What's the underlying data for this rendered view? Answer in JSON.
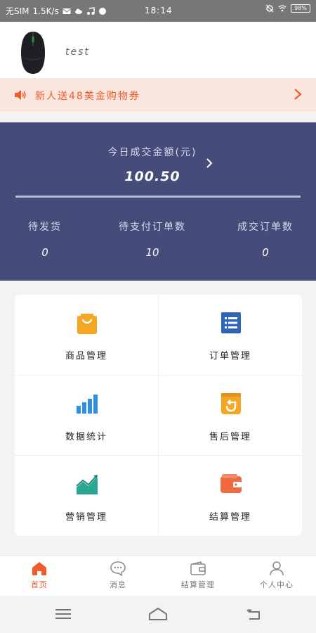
{
  "status_bar": {
    "carrier": "无SIM",
    "net_speed": "1.5K/s",
    "time": "18:14",
    "battery": "98%"
  },
  "profile": {
    "shop_name": "test"
  },
  "notice": {
    "text": "新人送48美金购物券"
  },
  "stats": {
    "amount_label": "今日成交金额(元)",
    "amount_value": "100.50",
    "columns": [
      {
        "label": "待发货",
        "value": "0"
      },
      {
        "label": "待支付订单数",
        "value": "10"
      },
      {
        "label": "成交订单数",
        "value": "0"
      }
    ]
  },
  "grid": [
    {
      "label": "商品管理",
      "icon": "shopping-bag-icon"
    },
    {
      "label": "订单管理",
      "icon": "order-list-icon"
    },
    {
      "label": "数据统计",
      "icon": "bar-chart-icon"
    },
    {
      "label": "售后管理",
      "icon": "after-sales-icon"
    },
    {
      "label": "营销管理",
      "icon": "marketing-chart-icon"
    },
    {
      "label": "结算管理",
      "icon": "wallet-icon"
    }
  ],
  "tabs": [
    {
      "label": "首页",
      "icon": "home-icon",
      "active": true
    },
    {
      "label": "消息",
      "icon": "message-icon",
      "active": false
    },
    {
      "label": "结算管理",
      "icon": "wallet-icon",
      "active": false
    },
    {
      "label": "个人中心",
      "icon": "user-icon",
      "active": false
    }
  ],
  "colors": {
    "accent": "#f15a2b",
    "banner": "#464c7a",
    "notice_bg": "#fbe6df",
    "icon_orange": "#f5a623",
    "icon_blue": "#2f64b8",
    "icon_teal": "#2aa791",
    "icon_red": "#f06a3f"
  }
}
